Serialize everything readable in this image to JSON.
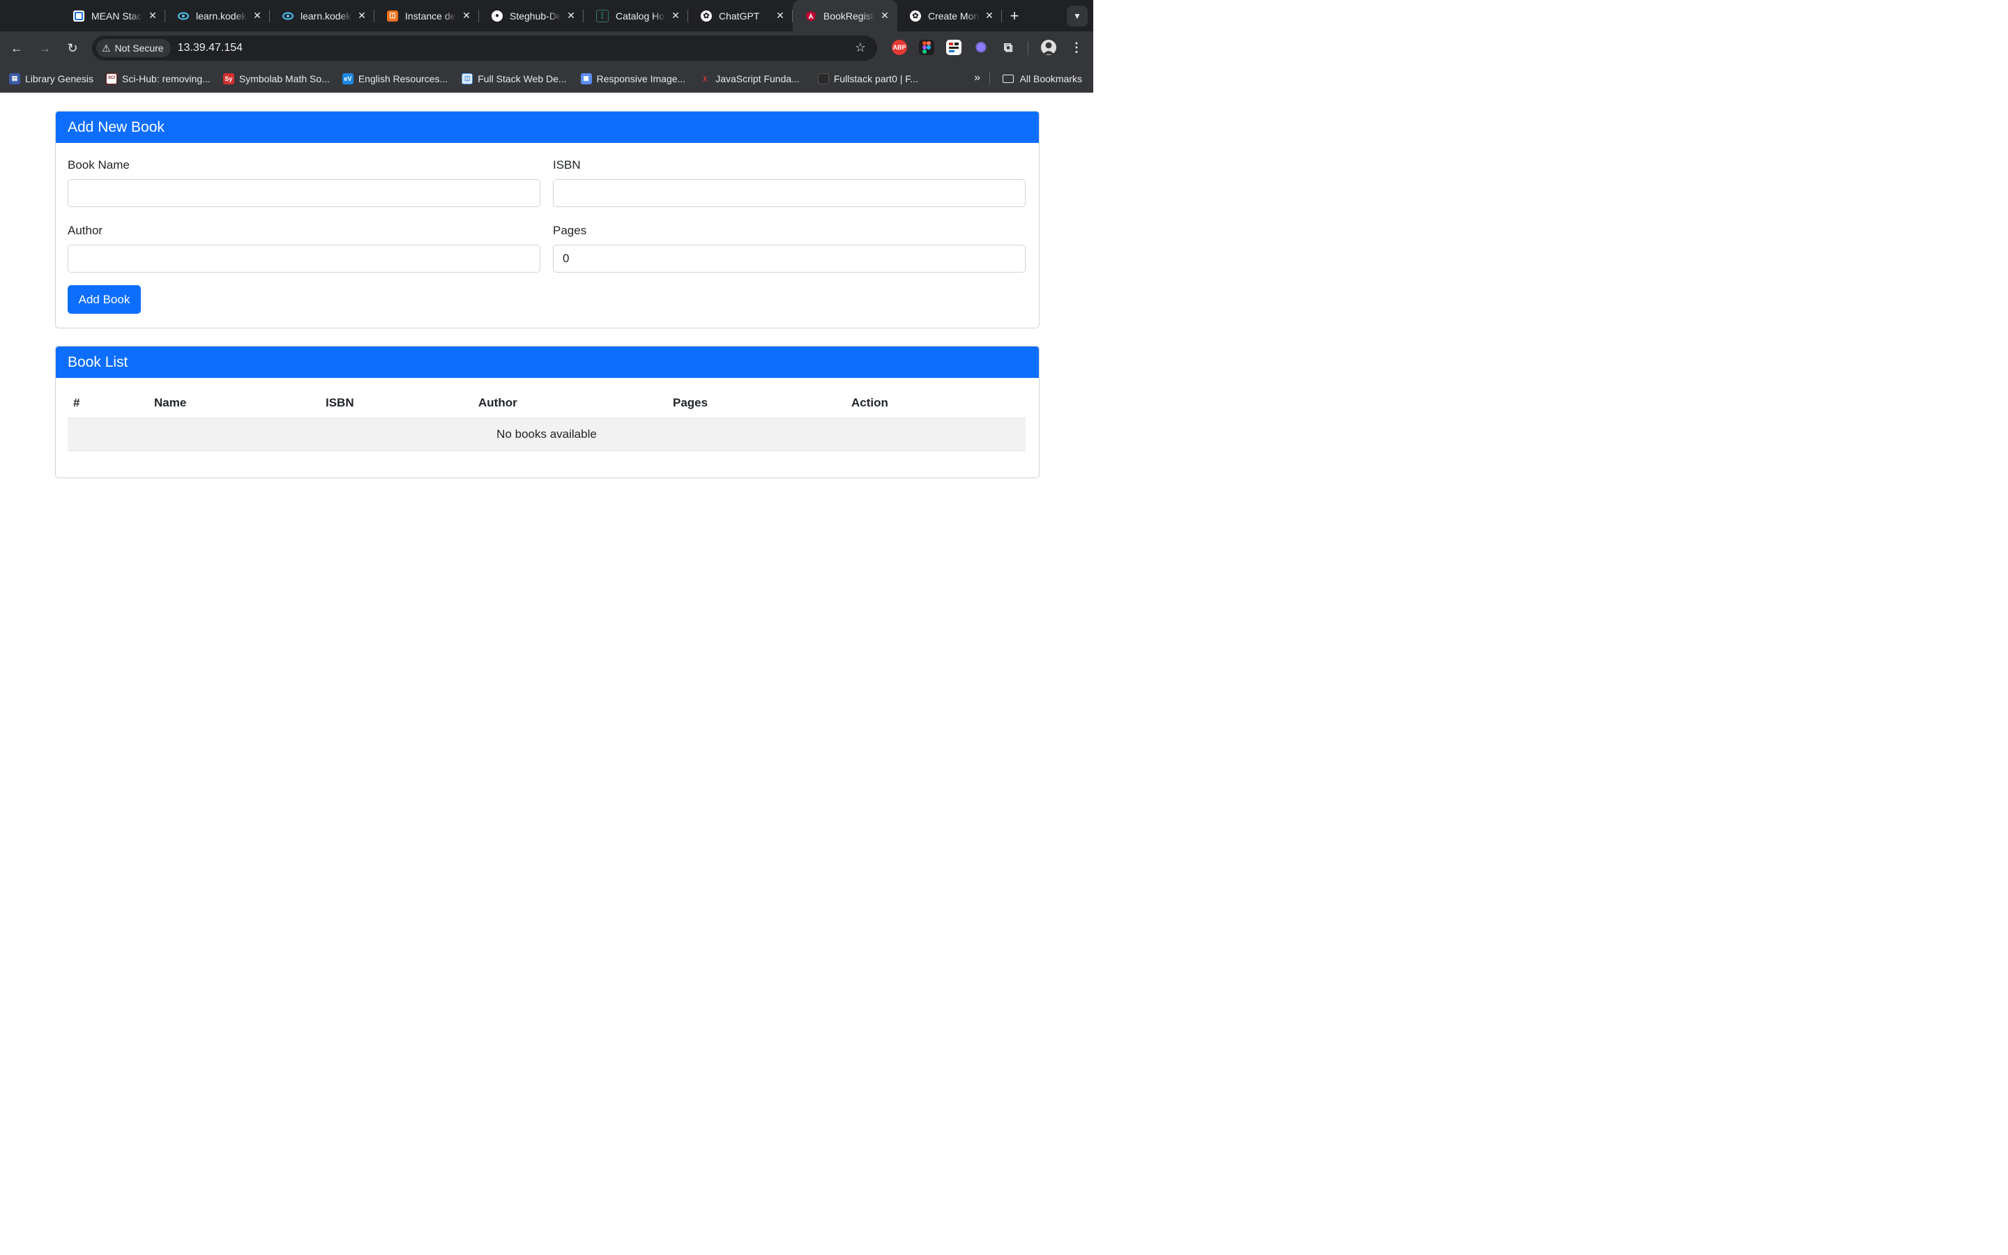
{
  "browser": {
    "tabs": [
      {
        "title": "MEAN Stack",
        "favicon": "kodekloud-logo",
        "active": false
      },
      {
        "title": "learn.kodekloud",
        "favicon": "kodekloud-cloud",
        "active": false
      },
      {
        "title": "learn.kodekloud",
        "favicon": "kodekloud-cloud",
        "active": false
      },
      {
        "title": "Instance details",
        "favicon": "aws-orange",
        "active": false
      },
      {
        "title": "Steghub-DevOps",
        "favicon": "github",
        "active": false
      },
      {
        "title": "Catalog Home",
        "favicon": "catalog",
        "active": false
      },
      {
        "title": "ChatGPT",
        "favicon": "openai",
        "active": false
      },
      {
        "title": "BookRegister",
        "favicon": "angular",
        "active": true
      },
      {
        "title": "Create Mon",
        "favicon": "openai",
        "active": false
      }
    ],
    "security_label": "Not Secure",
    "url": "13.39.47.154",
    "extensions": [
      "ABP"
    ],
    "bookmarks": [
      {
        "label": "Library Genesis",
        "icon": "LG",
        "color": "#3b5ba5"
      },
      {
        "label": "Sci-Hub: removing...",
        "icon": "SCI HUB",
        "color": "#8b1a1a"
      },
      {
        "label": "Symbolab Math So...",
        "icon": "Sy",
        "color": "#d32f2f"
      },
      {
        "label": "English Resources...",
        "icon": "eV",
        "color": "#1e88e5"
      },
      {
        "label": "Full Stack Web De...",
        "icon": "FS",
        "color": "#4a90d9"
      },
      {
        "label": "Responsive Image...",
        "icon": "RI",
        "color": "#5b8def"
      },
      {
        "label": "JavaScript Funda...",
        "icon": "X",
        "color": "#b71c1c"
      },
      {
        "label": "Fullstack part0 | F...",
        "icon": "",
        "color": "#3c3c3c"
      }
    ],
    "all_bookmarks_label": "All Bookmarks"
  },
  "add_form": {
    "title": "Add New Book",
    "book_name_label": "Book Name",
    "book_name_value": "",
    "isbn_label": "ISBN",
    "isbn_value": "",
    "author_label": "Author",
    "author_value": "",
    "pages_label": "Pages",
    "pages_value": "0",
    "submit_label": "Add Book"
  },
  "book_list": {
    "title": "Book List",
    "columns": [
      "#",
      "Name",
      "ISBN",
      "Author",
      "Pages",
      "Action"
    ],
    "empty_message": "No books available"
  },
  "colors": {
    "primary": "#0d6efd",
    "browser_frame": "#202124",
    "toolbar": "#35363a"
  }
}
